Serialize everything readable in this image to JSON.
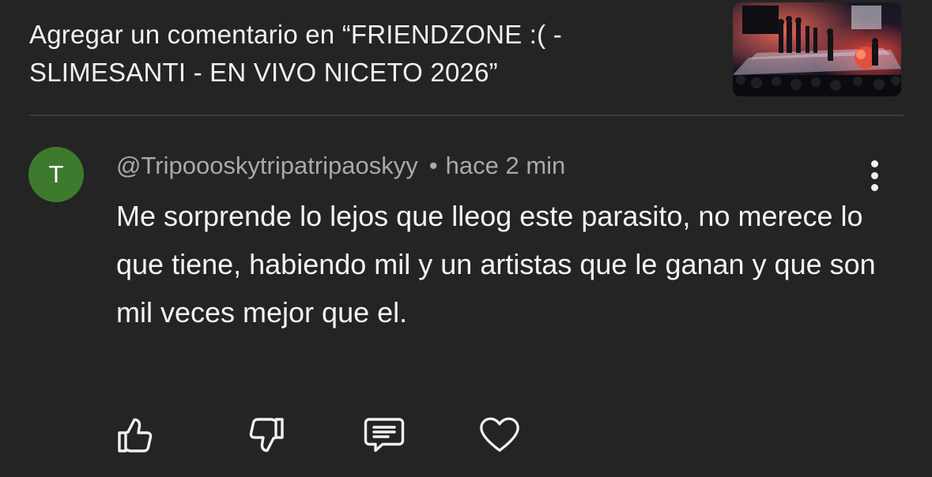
{
  "header": {
    "title": "Agregar un comentario en “FRIENDZONE :( - SLIMESANTI - EN VIVO NICETO 2026”"
  },
  "comment": {
    "avatar_letter": "T",
    "avatar_color": "#3e7a2d",
    "author": "@Tripoooskytripatripaoskyy",
    "separator": "•",
    "time": "hace 2 min",
    "text": "Me sorprende lo lejos que lleog este parasito, no merece lo que tiene, habiendo mil y un artistas que le ganan y que son mil veces mejor que el."
  },
  "actions": {
    "icons": [
      "thumbs-up-icon",
      "thumbs-down-icon",
      "reply-icon",
      "heart-icon"
    ]
  },
  "more_icon": "more-vertical-icon"
}
